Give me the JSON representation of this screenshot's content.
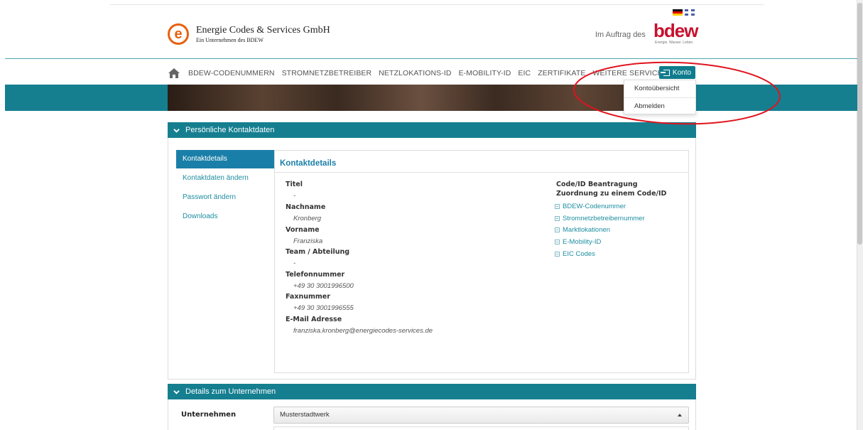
{
  "header": {
    "company_name": "Energie Codes & Services GmbH",
    "company_subtitle": "Ein Unternehmen des BDEW",
    "logo_letter": "e",
    "auftrag_text": "Im Auftrag des",
    "bdew_word": "bdew",
    "bdew_tagline": "Energie. Wasser. Leben.",
    "languages": [
      "de",
      "en"
    ]
  },
  "nav": {
    "items": [
      {
        "label": "BDEW-CODENUMMERN"
      },
      {
        "label": "STROMNETZBETREIBER"
      },
      {
        "label": "NETZLOKATIONS-ID"
      },
      {
        "label": "E-MOBILITY-ID"
      },
      {
        "label": "EIC"
      },
      {
        "label": "ZERTIFIKATE"
      },
      {
        "label": "WEITERE SERVICES"
      }
    ],
    "konto_label": "Konto"
  },
  "konto_menu": {
    "items": [
      {
        "label": "Kontoübersicht"
      },
      {
        "label": "Abmelden"
      }
    ]
  },
  "panel_personal": {
    "title": "Persönliche Kontaktdaten",
    "side_nav": [
      {
        "label": "Kontaktdetails",
        "active": true
      },
      {
        "label": "Kontaktdaten ändern",
        "active": false
      },
      {
        "label": "Passwort ändern",
        "active": false
      },
      {
        "label": "Downloads",
        "active": false
      }
    ],
    "content_title": "Kontaktdetails",
    "fields": [
      {
        "label": "Titel",
        "value": "-"
      },
      {
        "label": "Nachname",
        "value": "Kronberg"
      },
      {
        "label": "Vorname",
        "value": "Franziska"
      },
      {
        "label": "Team / Abteilung",
        "value": "-"
      },
      {
        "label": "Telefonnummer",
        "value": "+49 30 3001996500"
      },
      {
        "label": "Faxnummer",
        "value": "+49 30 3001996555"
      },
      {
        "label": "E-Mail Adresse",
        "value": "franziska.kronberg@energiecodes-services.de"
      }
    ],
    "code_heading_1": "Code/ID Beantragung",
    "code_heading_2": "Zuordnung zu einem Code/ID",
    "code_links": [
      {
        "label": "BDEW-Codenummer"
      },
      {
        "label": "Stromnetzbetreibernummer"
      },
      {
        "label": "Marktlokationen"
      },
      {
        "label": "E-Mobility-ID"
      },
      {
        "label": "EIC Codes"
      }
    ]
  },
  "panel_company": {
    "title": "Details zum Unternehmen",
    "unternehmen_label": "Unternehmen",
    "unternehmen_value": "Musterstadtwerk"
  },
  "colors": {
    "accent": "#157f90",
    "link": "#1e8ea0",
    "active_nav": "#1a7fa8",
    "logo_orange": "#e8600f",
    "bdew_red": "#c8102e",
    "annotation_red": "#e0141e"
  }
}
